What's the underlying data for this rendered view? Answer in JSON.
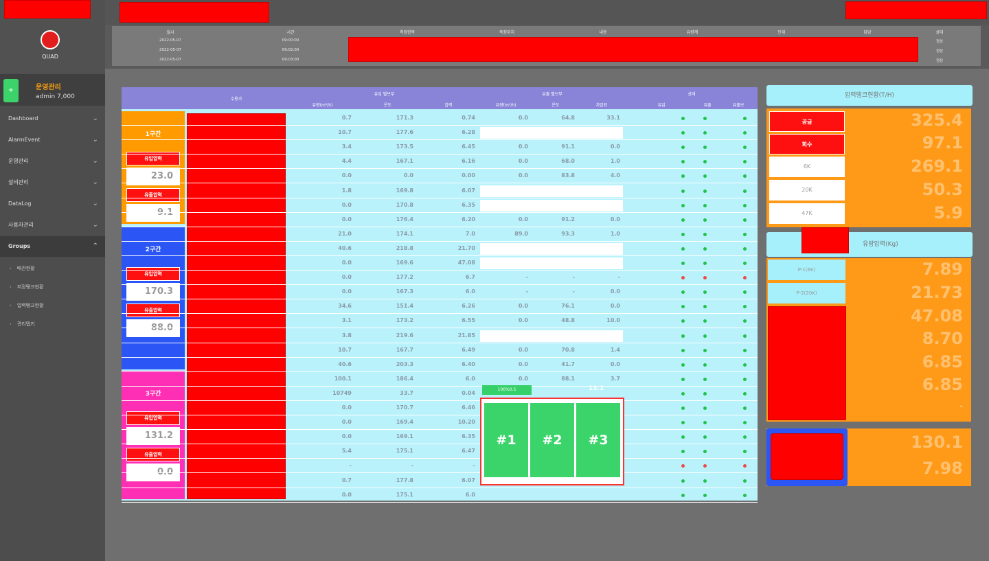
{
  "sidebar": {
    "logo_text": "QUAD",
    "user_name": "운영관리",
    "user_role": "admin 7,000",
    "user_button": "+",
    "menu": [
      {
        "label": "Dashboard"
      },
      {
        "label": "AlarmEvent"
      },
      {
        "label": "운영관리"
      },
      {
        "label": "설비관리"
      },
      {
        "label": "DataLog"
      },
      {
        "label": "사용자관리"
      },
      {
        "label": "Groups"
      }
    ],
    "submenu": [
      {
        "label": "배관현황"
      },
      {
        "label": "저장탱크현황"
      },
      {
        "label": "압력탱크현황"
      },
      {
        "label": "관리탭키"
      }
    ]
  },
  "history": {
    "columns": [
      "일시",
      "시간",
      "측정항목",
      "측정위치",
      "내용",
      "유량계",
      "단위",
      "담당",
      "상태"
    ],
    "rows": [
      [
        "2022-05-07",
        "09:00:00",
        "",
        "",
        "",
        "",
        "",
        "",
        "정상"
      ],
      [
        "2022-05-07",
        "09:02:00",
        "",
        "",
        "",
        "",
        "",
        "",
        "정상"
      ],
      [
        "2022-05-07",
        "09:03:00",
        "",
        "",
        "",
        "",
        "",
        "",
        "정상"
      ]
    ]
  },
  "table": {
    "header_group1": "유입 밸브부",
    "header_group2": "유출 밸브부",
    "header_group3": "상태",
    "header_name": "수용가",
    "sub_headers": [
      "유량(m³/h)",
      "온도",
      "압력",
      "유량(m³/h)",
      "온도",
      "차압표",
      "유입",
      "유출",
      "유출보"
    ],
    "rows": [
      {
        "a": "0.7",
        "b": "171.3",
        "c": "0.74",
        "d": "0.0",
        "e": "64.8",
        "f": "33.1",
        "blank": false
      },
      {
        "a": "10.7",
        "b": "177.6",
        "c": "6.28",
        "d": "",
        "e": "",
        "f": "",
        "blank": true
      },
      {
        "a": "3.4",
        "b": "173.5",
        "c": "6.45",
        "d": "0.0",
        "e": "91.1",
        "f": "0.0",
        "blank": false
      },
      {
        "a": "4.4",
        "b": "167.1",
        "c": "6.16",
        "d": "0.0",
        "e": "68.0",
        "f": "1.0",
        "blank": false
      },
      {
        "a": "0.0",
        "b": "0.0",
        "c": "0.00",
        "d": "0.0",
        "e": "83.8",
        "f": "4.0",
        "blank": false
      },
      {
        "a": "1.8",
        "b": "169.8",
        "c": "6.07",
        "d": "",
        "e": "",
        "f": "",
        "blank": true
      },
      {
        "a": "0.0",
        "b": "170.8",
        "c": "6.35",
        "d": "",
        "e": "",
        "f": "",
        "blank": true
      },
      {
        "a": "0.0",
        "b": "176.4",
        "c": "6.20",
        "d": "0.0",
        "e": "91.2",
        "f": "0.0",
        "blank": false
      },
      {
        "a": "21.0",
        "b": "174.1",
        "c": "7.0",
        "d": "89.0",
        "e": "93.3",
        "f": "1.0",
        "blank": false
      },
      {
        "a": "40.6",
        "b": "218.8",
        "c": "21.70",
        "d": "",
        "e": "",
        "f": "",
        "blank": true
      },
      {
        "a": "0.0",
        "b": "169.6",
        "c": "47.08",
        "d": "",
        "e": "",
        "f": "",
        "blank": true
      },
      {
        "a": "0.0",
        "b": "177.2",
        "c": "6.7",
        "d": "-",
        "e": "-",
        "f": "-",
        "blank": false
      },
      {
        "a": "0.0",
        "b": "167.3",
        "c": "6.0",
        "d": "-",
        "e": "-",
        "f": "0.0",
        "blank": false
      },
      {
        "a": "34.6",
        "b": "151.4",
        "c": "6.26",
        "d": "0.0",
        "e": "76.1",
        "f": "0.0",
        "blank": false
      },
      {
        "a": "3.1",
        "b": "173.2",
        "c": "6.55",
        "d": "0.0",
        "e": "48.8",
        "f": "10.0",
        "blank": false
      },
      {
        "a": "3.8",
        "b": "219.6",
        "c": "21.85",
        "d": "",
        "e": "",
        "f": "",
        "blank": true
      },
      {
        "a": "10.7",
        "b": "167.7",
        "c": "6.49",
        "d": "0.0",
        "e": "70.8",
        "f": "1.4",
        "blank": false
      },
      {
        "a": "40.6",
        "b": "203.3",
        "c": "6.40",
        "d": "0.0",
        "e": "41.7",
        "f": "0.0",
        "blank": false
      },
      {
        "a": "100.1",
        "b": "186.4",
        "c": "6.0",
        "d": "0.0",
        "e": "88.1",
        "f": "3.7",
        "blank": false
      },
      {
        "a": "10749",
        "b": "33.7",
        "c": "0.04",
        "d": "",
        "e": "",
        "f": "",
        "blank": false
      },
      {
        "a": "0.0",
        "b": "170.7",
        "c": "6.46",
        "d": "",
        "e": "",
        "f": "",
        "blank": false
      },
      {
        "a": "0.0",
        "b": "169.4",
        "c": "10.20",
        "d": "",
        "e": "",
        "f": "",
        "blank": false
      },
      {
        "a": "0.0",
        "b": "169.1",
        "c": "6.35",
        "d": "",
        "e": "",
        "f": "",
        "blank": false
      },
      {
        "a": "5.4",
        "b": "175.1",
        "c": "6.47",
        "d": "",
        "e": "",
        "f": "",
        "blank": false
      },
      {
        "a": "-",
        "b": "-",
        "c": "-",
        "d": "",
        "e": "",
        "f": "",
        "blank": false
      },
      {
        "a": "0.7",
        "b": "177.8",
        "c": "6.07",
        "d": "",
        "e": "",
        "f": "",
        "blank": false
      },
      {
        "a": "0.0",
        "b": "175.1",
        "c": "6.0",
        "d": "",
        "e": "",
        "f": "",
        "blank": true
      }
    ],
    "green_tag": "100%0.5",
    "green_value": "13.1",
    "sensors": [
      "#1",
      "#2",
      "#3"
    ]
  },
  "zones": [
    {
      "name": "1구간",
      "badge1": "유입압력",
      "value1": "23.0",
      "badge2": "유출압력",
      "value2": "9.1",
      "color": "#ff9a00"
    },
    {
      "name": "2구간",
      "badge1": "유입압력",
      "value1": "170.3",
      "badge2": "유출압력",
      "value2": "88.0",
      "color": "#2b56f5"
    },
    {
      "name": "3구간",
      "badge1": "유입압력",
      "value1": "131.2",
      "badge2": "유출압력",
      "value2": "0.0",
      "color": "#ff2fb5"
    }
  ],
  "right1": {
    "title": "압력탱크현황(T/H)",
    "rows": [
      {
        "label": "공급",
        "style": "red",
        "value": "325.4"
      },
      {
        "label": "회수",
        "style": "red",
        "value": "97.1"
      },
      {
        "label": "6K",
        "style": "white",
        "value": "269.1"
      },
      {
        "label": "20K",
        "style": "white",
        "value": "50.3"
      },
      {
        "label": "47K",
        "style": "white",
        "value": "5.9"
      }
    ]
  },
  "right2": {
    "title": "유량압력(Kg)",
    "rows": [
      {
        "label": "P-1(6K)",
        "value": "7.89"
      },
      {
        "label": "P-2(20K)",
        "value": "21.73"
      },
      {
        "label": "",
        "value": "47.08"
      },
      {
        "label": "",
        "value": "8.70"
      },
      {
        "label": "",
        "value": "6.85"
      },
      {
        "label": "",
        "value": "6.85"
      },
      {
        "label": "",
        "value": "-"
      }
    ]
  },
  "right3": {
    "value1": "130.1",
    "value2": "7.98"
  }
}
